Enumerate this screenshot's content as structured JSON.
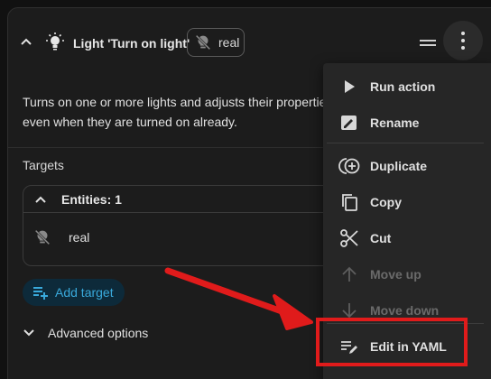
{
  "header": {
    "title": "Light 'Turn on light'",
    "chip_label": "real"
  },
  "description": "Turns on one or more lights and adjusts their properties, even when they are turned on already.",
  "targets": {
    "label": "Targets",
    "entities_header": "Entities: 1",
    "entities": [
      {
        "name": "real",
        "icon": "lightbulb-off-icon"
      }
    ],
    "add_target_label": "Add target"
  },
  "advanced_label": "Advanced options",
  "menu": {
    "items": [
      {
        "label": "Run action",
        "icon": "play-icon",
        "disabled": false
      },
      {
        "label": "Rename",
        "icon": "rename-icon",
        "disabled": false
      },
      {
        "label": "Duplicate",
        "icon": "duplicate-icon",
        "disabled": false
      },
      {
        "label": "Copy",
        "icon": "copy-icon",
        "disabled": false
      },
      {
        "label": "Cut",
        "icon": "scissors-icon",
        "disabled": false
      },
      {
        "label": "Move up",
        "icon": "arrow-up-icon",
        "disabled": true
      },
      {
        "label": "Move down",
        "icon": "arrow-down-icon",
        "disabled": true
      },
      {
        "label": "Edit in YAML",
        "icon": "edit-yaml-icon",
        "disabled": false
      }
    ]
  },
  "colors": {
    "accent": "#39a9db",
    "annotation": "#e01b1b",
    "background": "#1c1c1c"
  }
}
